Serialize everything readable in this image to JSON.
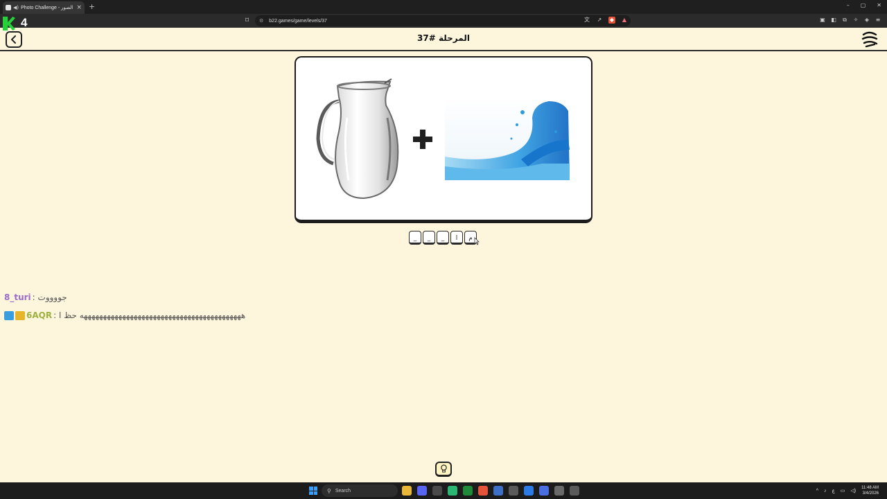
{
  "browser": {
    "tab_title": "Photo Challenge - تحدي الصور",
    "url": "b22.games/game/levels/37",
    "new_tab": "+",
    "tab_close": "×",
    "win_controls": [
      "–",
      "▢",
      "✕"
    ]
  },
  "overlay": {
    "channel_number": "4"
  },
  "header": {
    "level_title": "المرحلة #37"
  },
  "puzzle": {
    "images": [
      "jug-image",
      "water-image"
    ],
    "operator": "+"
  },
  "answer": {
    "slots": [
      "_",
      "_",
      "_",
      "ا",
      "م"
    ]
  },
  "chat": [
    {
      "user": "8_turi",
      "message": ": جووووت"
    },
    {
      "user": "6AQR",
      "message": ": ههههههههههههههههههههههههههههههههههههههههههه حظ ا"
    }
  ],
  "taskbar": {
    "search_label": "Search",
    "time": "11:48 AM",
    "date": "3/4/2026",
    "lang": "ع"
  },
  "colors": {
    "page_background": "#fdf6dc",
    "accent_green": "#27d13a",
    "chat_name_purple": "#9b6cc9",
    "chat_name_olive": "#9fb040"
  }
}
